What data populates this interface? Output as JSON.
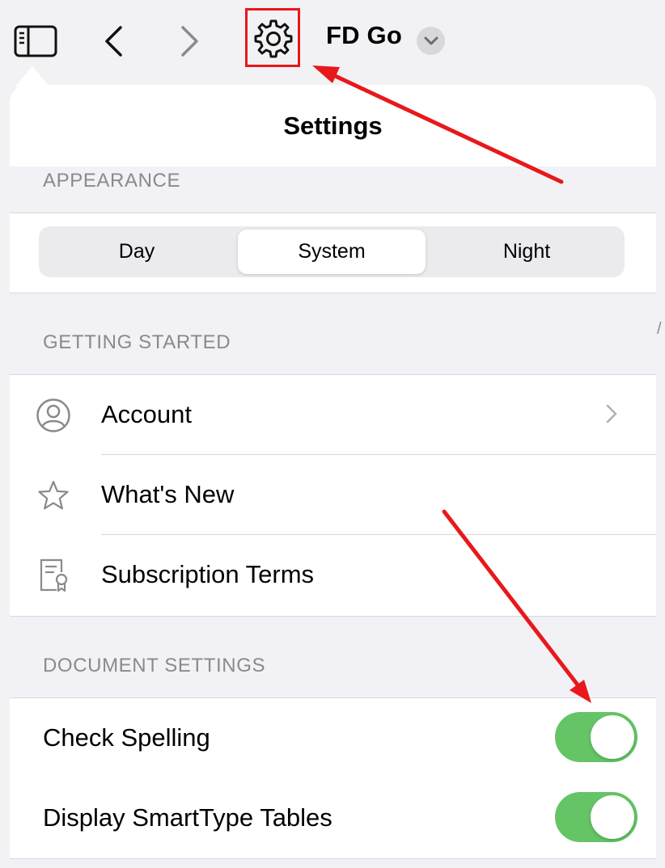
{
  "toolbar": {
    "sidebar_icon": "sidebar-icon",
    "back_icon": "chevron-left-icon",
    "forward_icon": "chevron-right-icon",
    "settings_icon": "gear-icon",
    "document_title": "FD Go",
    "title_menu_icon": "chevron-down-icon"
  },
  "settings": {
    "title": "Settings",
    "appearance": {
      "header": "APPEARANCE",
      "options": [
        "Day",
        "System",
        "Night"
      ],
      "selected": "System"
    },
    "getting_started": {
      "header": "GETTING STARTED",
      "items": [
        {
          "label": "Account",
          "icon": "person-circle-icon",
          "has_chevron": true
        },
        {
          "label": "What's New",
          "icon": "star-icon",
          "has_chevron": false
        },
        {
          "label": "Subscription Terms",
          "icon": "certificate-document-icon",
          "has_chevron": false
        }
      ]
    },
    "document_settings": {
      "header": "DOCUMENT SETTINGS",
      "items": [
        {
          "label": "Check Spelling",
          "on": true
        },
        {
          "label": "Display SmartType Tables",
          "on": true
        }
      ]
    }
  },
  "partial_edge_text": "/",
  "colors": {
    "toggle_on": "#65c466",
    "annotation_red": "#e8181b",
    "section_label": "#8a8a8e",
    "background": "#f2f2f6"
  }
}
